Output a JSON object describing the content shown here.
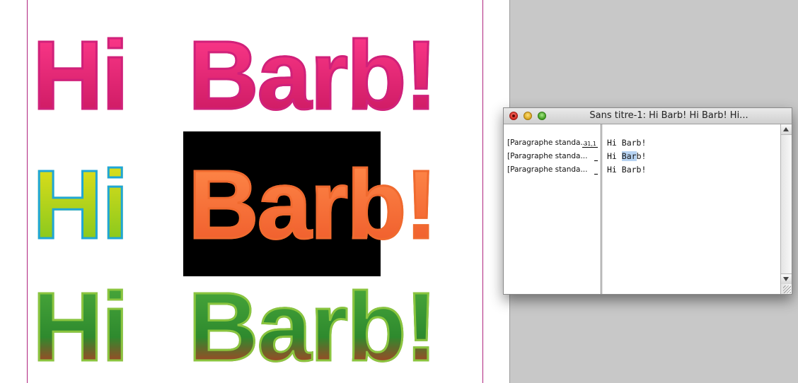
{
  "document": {
    "words": {
      "row1_hi": "Hi",
      "row1_barb": "Barb!",
      "row2_hi": "Hi",
      "row2_barb": "Barb!",
      "row3_hi": "Hi",
      "row3_barb": "Barb!"
    }
  },
  "story_editor": {
    "title": "Sans titre-1: Hi Barb! Hi Barb! Hi...",
    "paragraphs": [
      {
        "style": "[Paragraphe standa...",
        "depth": "31,1",
        "text": "Hi Barb!"
      },
      {
        "style": "[Paragraphe standa...",
        "depth": "",
        "text_before": "Hi ",
        "text_selected": "Bar",
        "text_after": "b!"
      },
      {
        "style": "[Paragraphe standa...",
        "depth": "",
        "text": "Hi Barb!"
      }
    ]
  },
  "colors": {
    "margin_guide": "#b0247e",
    "pasteboard": "#c8c8c8",
    "row1_stroke": "#d0217a",
    "row2_stroke": "#1fa6d8",
    "row2_center_stroke": "#f06a2f",
    "row3_stroke": "#8bc53f",
    "selection": "#b7d3f2"
  }
}
